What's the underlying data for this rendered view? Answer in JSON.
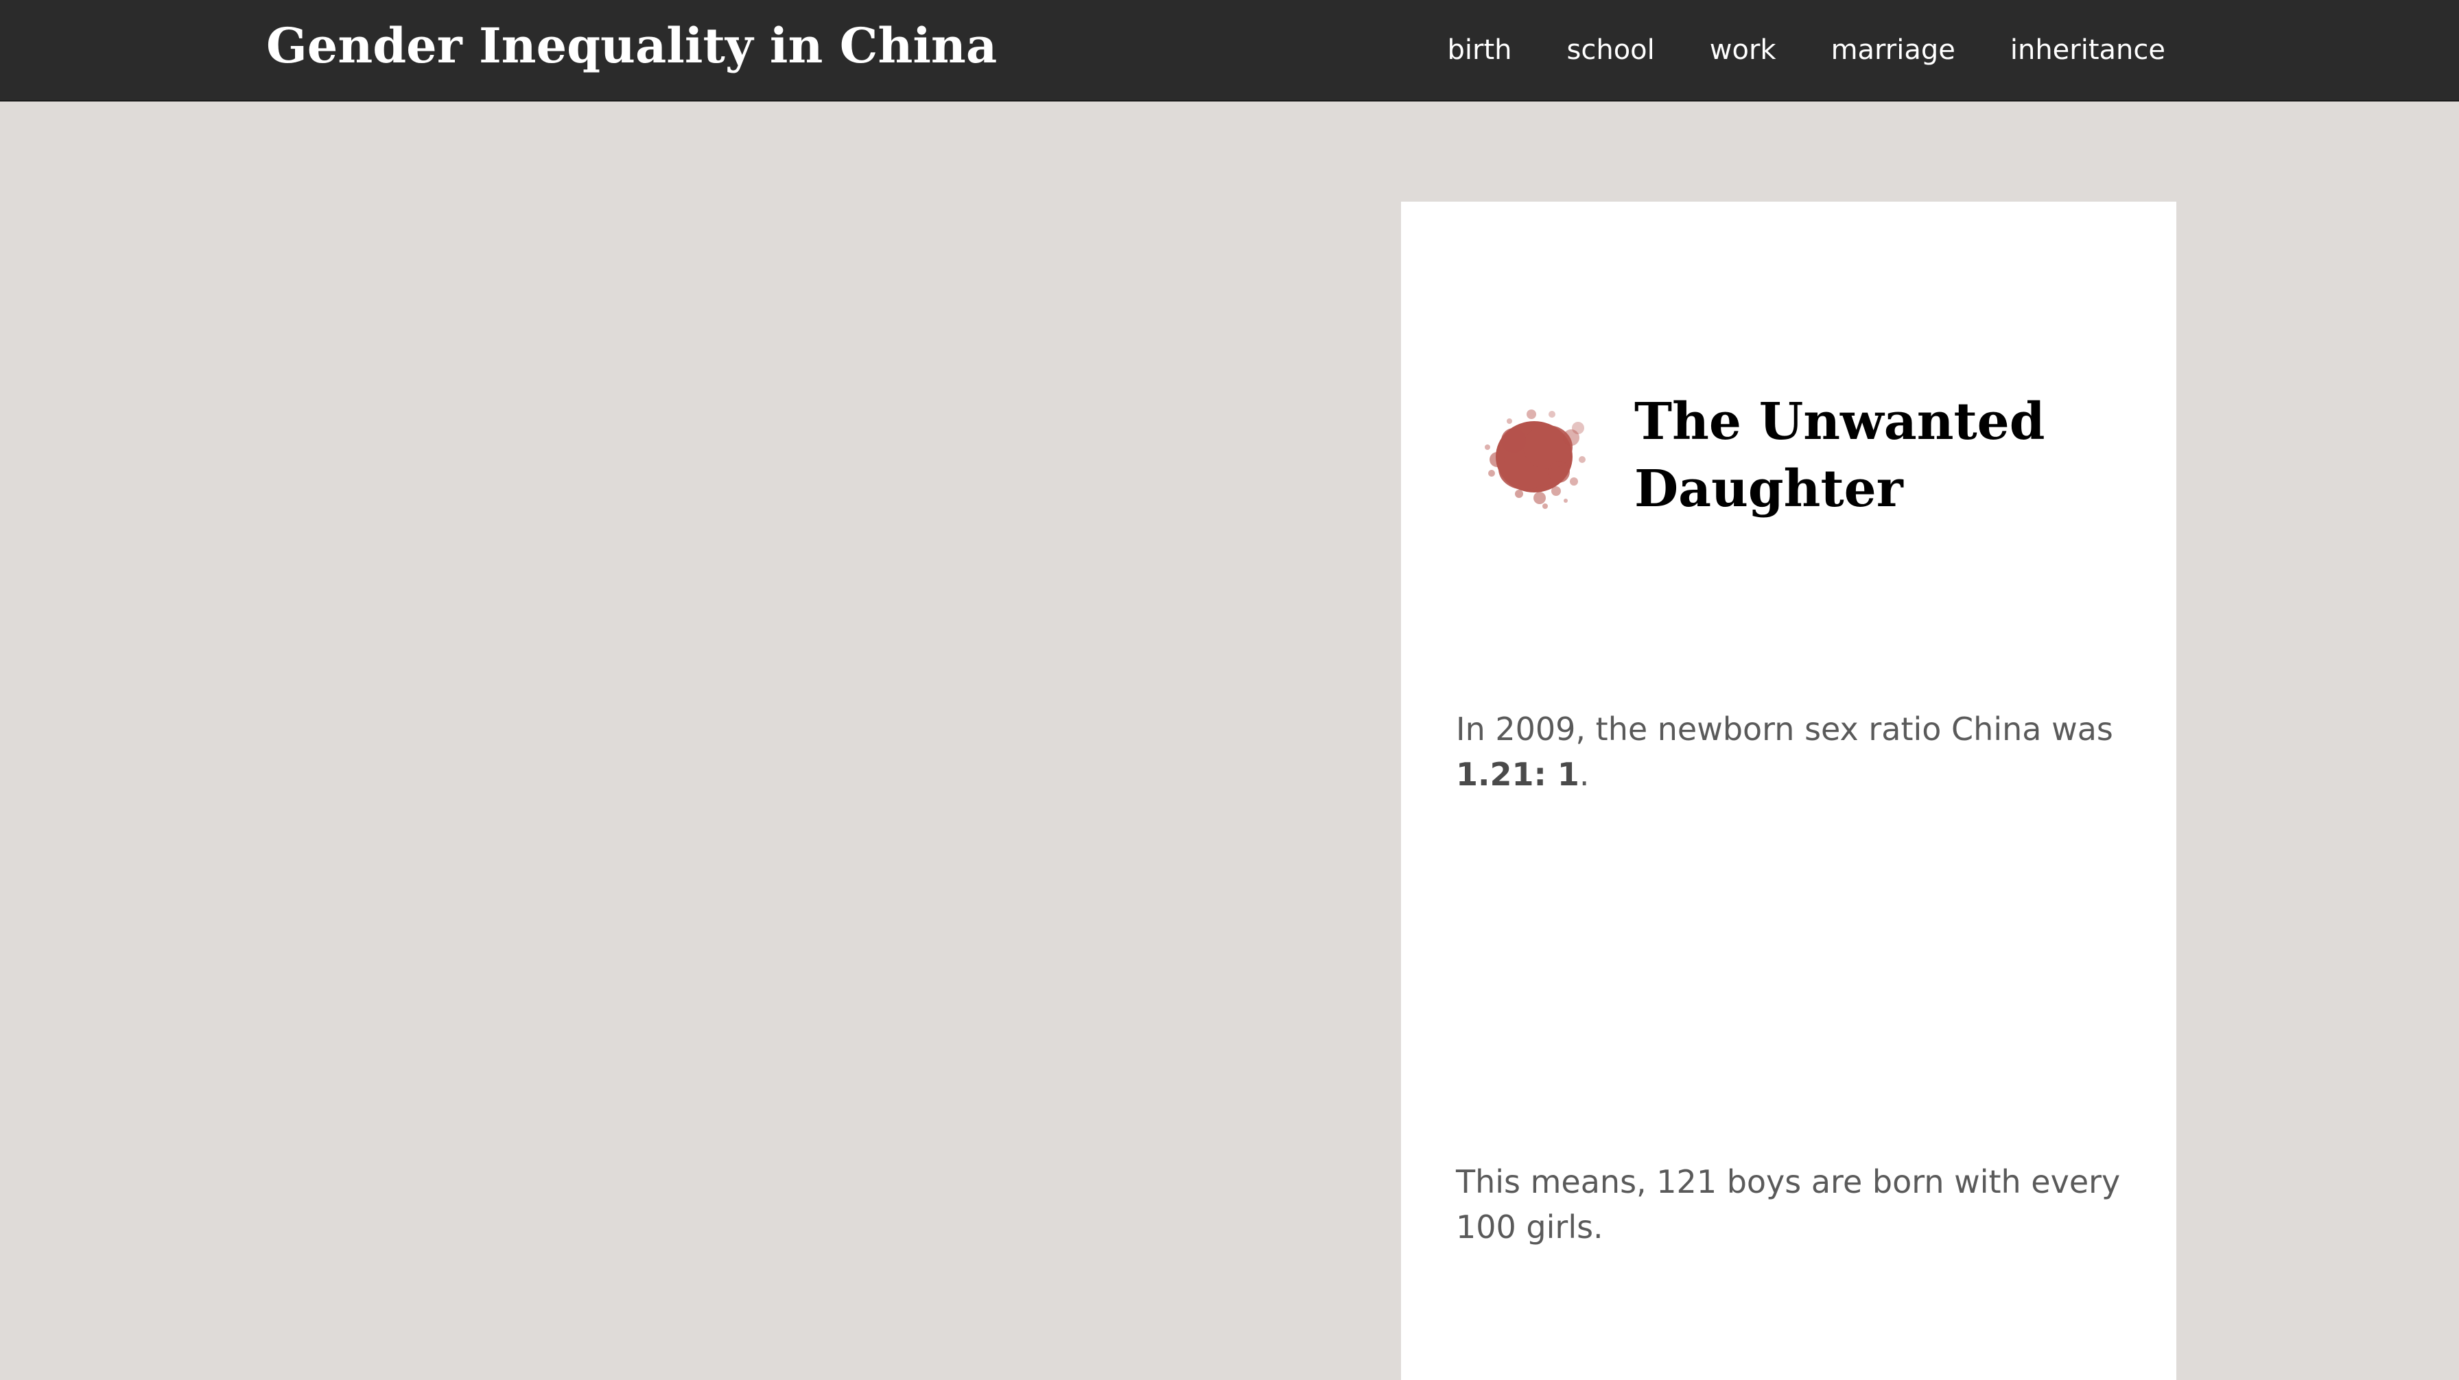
{
  "header": {
    "site_title": "Gender Inequality in China",
    "nav": [
      {
        "label": "birth"
      },
      {
        "label": "school"
      },
      {
        "label": "work"
      },
      {
        "label": "marriage"
      },
      {
        "label": "inheritance"
      }
    ]
  },
  "card": {
    "icon": "paint-splat-icon",
    "title": "The Unwanted Daughter",
    "paragraph1": {
      "before": "In 2009, the newborn sex ratio China was ",
      "bold": "1.21: 1",
      "after": "."
    },
    "paragraph2": "This means, 121 boys are born with every 100 girls."
  },
  "colors": {
    "background": "#dfdbd8",
    "header": "#2b2b2b",
    "card": "#ffffff",
    "splat": "#b5534c",
    "body_text": "#5a5a5a"
  }
}
